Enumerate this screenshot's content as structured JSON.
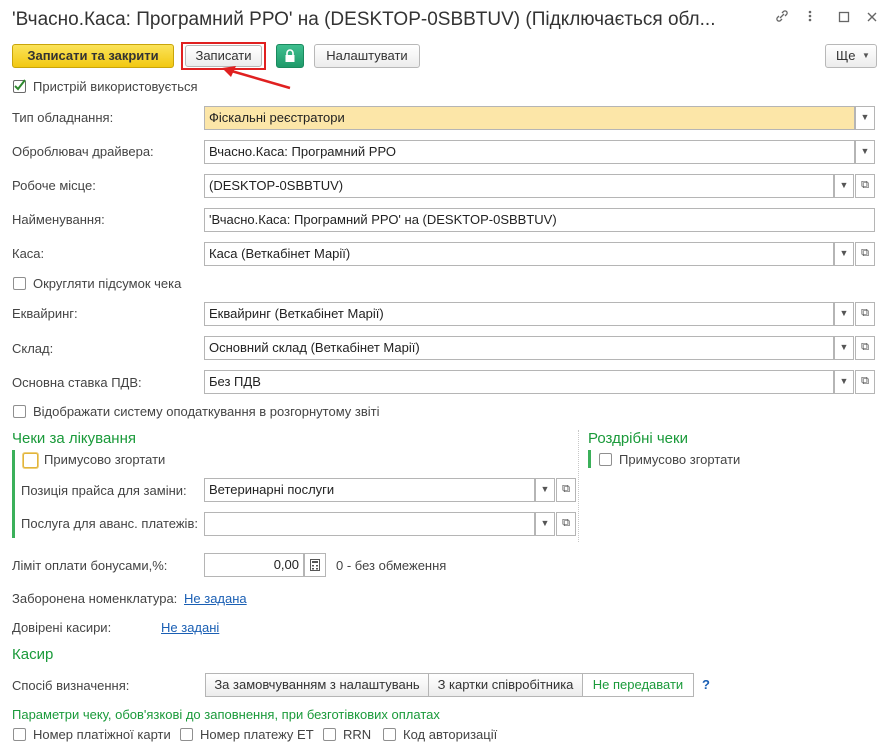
{
  "window": {
    "title": "'Вчасно.Каса: Програмний РРО' на (DESKTOP-0SBBTUV) (Підключається обл...",
    "link_icon": "link-icon",
    "menu_icon": "more-vertical-icon",
    "restore_icon": "restore-icon",
    "close_icon": "close-icon"
  },
  "toolbar": {
    "save_close_label": "Записати та закрити",
    "save_label": "Записати",
    "lock_icon": "lock-icon",
    "configure_label": "Налаштувати",
    "more_label": "Ще"
  },
  "form": {
    "device_used_label": "Пристрій використовується",
    "device_used_checked": true,
    "equipment_type_label": "Тип обладнання:",
    "equipment_type_value": "Фіскальні реєстратори",
    "driver_label": "Оброблювач драйвера:",
    "driver_value": "Вчасно.Каса: Програмний РРО",
    "workplace_label": "Робоче місце:",
    "workplace_value": "(DESKTOP-0SBBTUV)",
    "name_label": "Найменування:",
    "name_value": "'Вчасно.Каса: Програмний РРО' на (DESKTOP-0SBBTUV)",
    "cashbox_label": "Каса:",
    "cashbox_value": "Каса (Веткабінет Марії)",
    "round_total_label": "Округляти підсумок чека",
    "acquiring_label": "Еквайринг:",
    "acquiring_value": "Еквайринг (Веткабінет Марії)",
    "warehouse_label": "Склад:",
    "warehouse_value": "Основний склад (Веткабінет Марії)",
    "vat_label": "Основна ставка ПДВ:",
    "vat_value": "Без ПДВ",
    "show_tax_label": "Відображати систему оподаткування в розгорнутому звіті"
  },
  "treatment_checks": {
    "title": "Чеки за лікування",
    "force_collapse_label": "Примусово згортати",
    "price_position_label": "Позиція прайса для заміни:",
    "price_position_value": "Ветеринарні послуги",
    "advance_service_label": "Послуга для аванс. платежів:",
    "advance_service_value": ""
  },
  "retail_checks": {
    "title": "Роздрібні чеки",
    "force_collapse_label": "Примусово згортати"
  },
  "bonus": {
    "label": "Ліміт оплати бонусами,%:",
    "value": "0,00",
    "calc_icon": "calculator-icon",
    "hint": "0 - без обмеження"
  },
  "forbidden": {
    "label": "Заборонена номенклатура:",
    "link": "Не задана"
  },
  "trusted": {
    "label": "Довірені касири:",
    "link": "Не задані"
  },
  "cashier": {
    "title": "Касир",
    "method_label": "Спосіб визначення:",
    "options": [
      "За замовчуванням з налаштувань",
      "З картки співробітника",
      "Не передавати"
    ],
    "selected": "Не передавати",
    "help": "?"
  },
  "noncash": {
    "note": "Параметри чеку, обов'язкові до заповнення, при безготівкових оплатах",
    "options": [
      "Номер платіжної карти",
      "Номер платежу ЕТ",
      "RRN",
      "Код авторизації"
    ]
  },
  "colors": {
    "accent_green": "#1a9a3a",
    "link_blue": "#1a5fb4",
    "primary_yellow": "#f2c811",
    "highlight_red": "#e02020",
    "field_highlight": "#fce6a8"
  }
}
